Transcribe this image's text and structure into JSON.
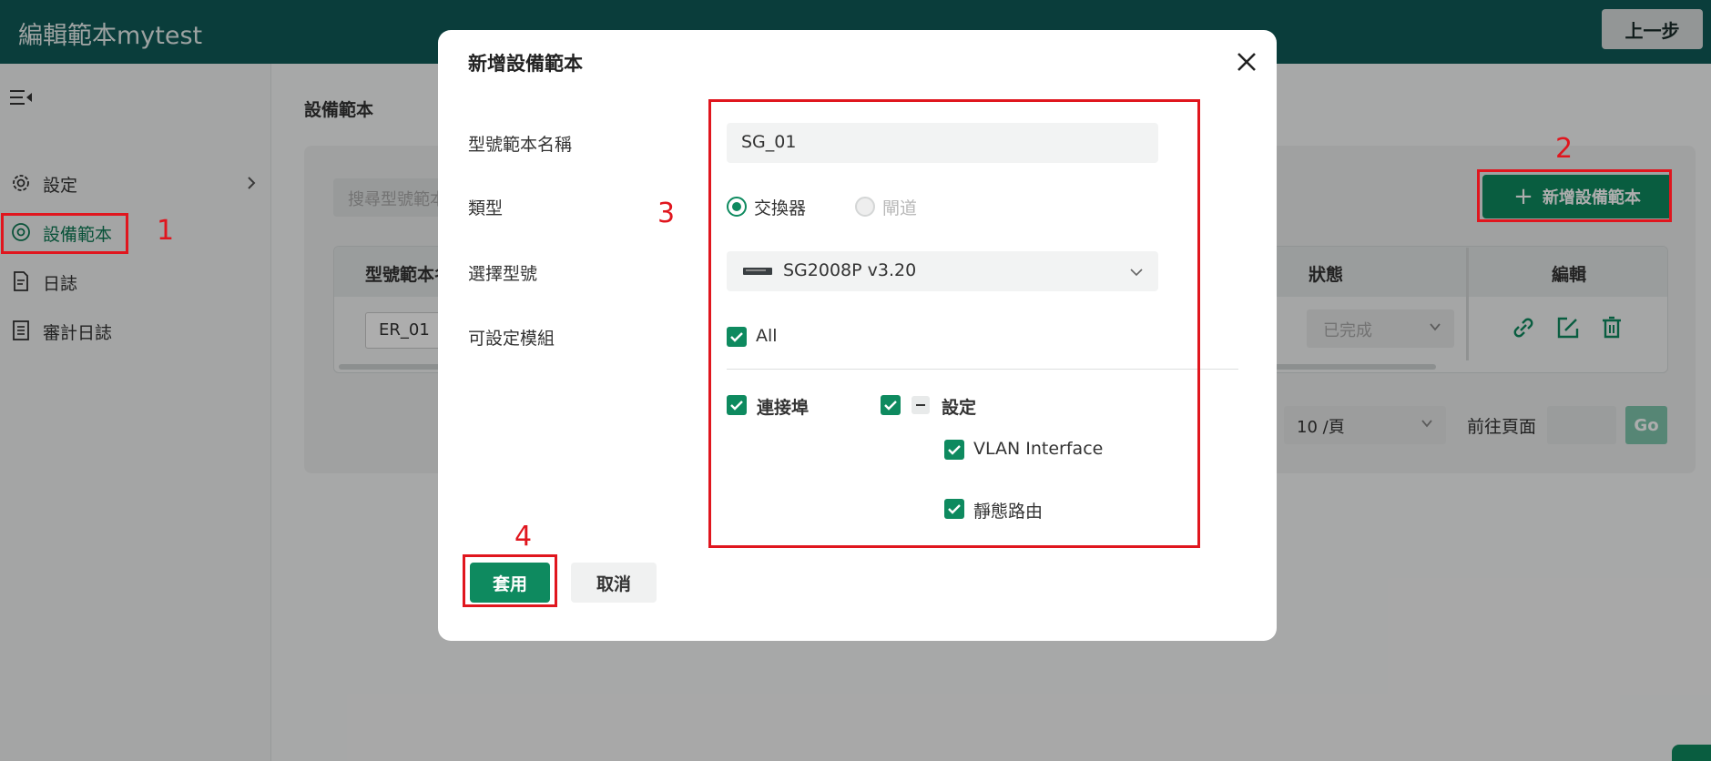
{
  "app": {
    "title": "編輯範本mytest",
    "back_label": "上一步"
  },
  "sidebar": {
    "items": [
      {
        "label": "設定",
        "icon": "gear-icon"
      },
      {
        "label": "設備範本",
        "icon": "target-icon",
        "active": true
      },
      {
        "label": "日誌",
        "icon": "document-icon"
      },
      {
        "label": "審計日誌",
        "icon": "list-document-icon"
      }
    ]
  },
  "main": {
    "title": "設備範本",
    "search_placeholder": "搜尋型號範本",
    "add_button": "新增設備範本",
    "table": {
      "columns": [
        "型號範本名",
        "狀態",
        "編輯"
      ],
      "rows": [
        {
          "name": "ER_01",
          "status": "已完成"
        }
      ]
    },
    "pagination": {
      "per_page": "10 /頁",
      "goto_label": "前往頁面",
      "go_label": "Go"
    }
  },
  "modal": {
    "title": "新增設備範本",
    "fields": {
      "name_label": "型號範本名稱",
      "name_value": "SG_01",
      "type_label": "類型",
      "type_options": [
        {
          "label": "交換器",
          "selected": true
        },
        {
          "label": "閘道",
          "selected": false,
          "disabled": true
        }
      ],
      "model_label": "選擇型號",
      "model_value": "SG2008P v3.20",
      "modules_label": "可設定模組",
      "all_label": "All"
    },
    "modules": {
      "ports": "連接埠",
      "settings": "設定",
      "vlan": "VLAN Interface",
      "static_route": "靜態路由"
    },
    "apply_label": "套用",
    "cancel_label": "取消"
  },
  "annotations": [
    "1",
    "2",
    "3",
    "4"
  ],
  "colors": {
    "brand_dark": "#0f5a58",
    "accent_green": "#0e8a5f",
    "annotation_red": "#e0161e"
  }
}
